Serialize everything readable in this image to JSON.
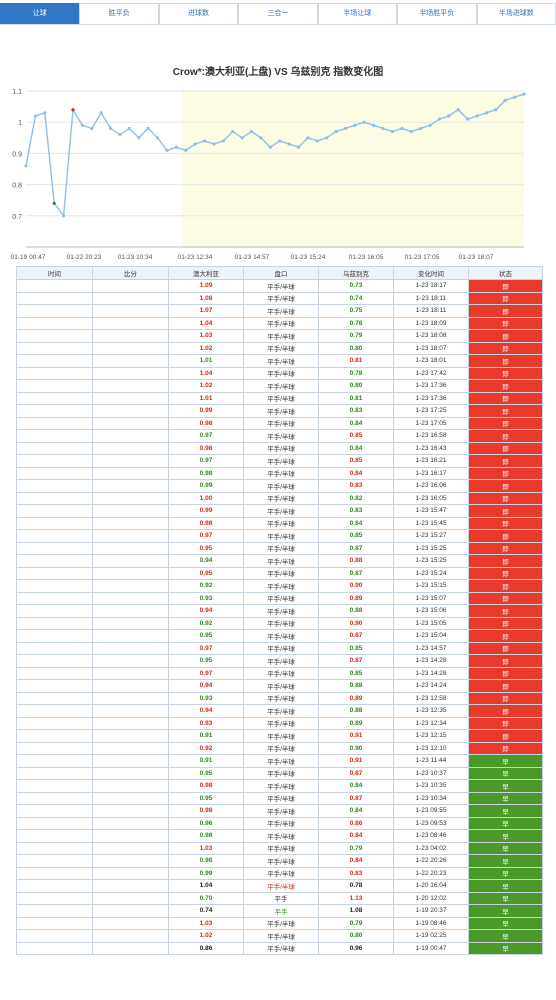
{
  "tabs": [
    {
      "label": "让球",
      "active": true
    },
    {
      "label": "胜平负",
      "active": false
    },
    {
      "label": "进球数",
      "active": false
    },
    {
      "label": "三合一",
      "active": false
    },
    {
      "label": "半场让球",
      "active": false
    },
    {
      "label": "半场胜平负",
      "active": false
    },
    {
      "label": "半场进球数",
      "active": false
    }
  ],
  "colors": {
    "up": "#d42a1a",
    "down": "#2d8a1f",
    "accent": "#2f78c8",
    "closed": "#e8392b",
    "early": "#4a9a2a",
    "line": "#8fbfe8",
    "band": "#fcfbe3"
  },
  "chart_data": {
    "type": "line",
    "title": "Crow*:澳大利亚(上盘) VS 乌兹别克 指数变化图",
    "ylim": [
      0.6,
      1.1
    ],
    "yticks": [
      "0.7",
      "0.8",
      "0.9",
      "1",
      "1.1"
    ],
    "xtick_labels": [
      "01-19 00:47",
      "01-22 20:23",
      "01-23 10:34",
      "01-23 12:34",
      "01-23 14:57",
      "01-23 15:24",
      "01-23 16:05",
      "01-23 17:05",
      "01-23 18:07"
    ],
    "grid": true,
    "legend": "none",
    "values": [
      0.86,
      1.02,
      1.03,
      0.74,
      0.7,
      1.04,
      0.99,
      0.98,
      1.03,
      0.98,
      0.96,
      0.98,
      0.95,
      0.98,
      0.95,
      0.91,
      0.92,
      0.91,
      0.93,
      0.94,
      0.93,
      0.94,
      0.97,
      0.95,
      0.97,
      0.95,
      0.92,
      0.94,
      0.93,
      0.92,
      0.95,
      0.94,
      0.95,
      0.97,
      0.98,
      0.99,
      1.0,
      0.99,
      0.98,
      0.97,
      0.98,
      0.97,
      0.98,
      0.99,
      1.01,
      1.02,
      1.04,
      1.01,
      1.02,
      1.03,
      1.04,
      1.07,
      1.08,
      1.09
    ],
    "highlight_start_index": 16
  },
  "table": {
    "headers": [
      "时间",
      "比分",
      "澳大利亚",
      "盘口",
      "乌兹别克",
      "变化时间",
      "状态"
    ],
    "rows": [
      {
        "home": "1.09",
        "hc": "up",
        "handicap": "平手/半球",
        "hstyle": "",
        "away": "0.73",
        "ac": "down",
        "time": "1-23 18:17",
        "status": "即",
        "sc": "closed"
      },
      {
        "home": "1.08",
        "hc": "up",
        "handicap": "平手/半球",
        "hstyle": "",
        "away": "0.74",
        "ac": "down",
        "time": "1-23 18:11",
        "status": "即",
        "sc": "closed"
      },
      {
        "home": "1.07",
        "hc": "up",
        "handicap": "平手/半球",
        "hstyle": "",
        "away": "0.75",
        "ac": "down",
        "time": "1-23 18:11",
        "status": "即",
        "sc": "closed"
      },
      {
        "home": "1.04",
        "hc": "up",
        "handicap": "平手/半球",
        "hstyle": "",
        "away": "0.78",
        "ac": "down",
        "time": "1-23 18:09",
        "status": "即",
        "sc": "closed"
      },
      {
        "home": "1.03",
        "hc": "up",
        "handicap": "平手/半球",
        "hstyle": "",
        "away": "0.79",
        "ac": "down",
        "time": "1-23 18:08",
        "status": "即",
        "sc": "closed"
      },
      {
        "home": "1.02",
        "hc": "up",
        "handicap": "平手/半球",
        "hstyle": "",
        "away": "0.80",
        "ac": "down",
        "time": "1-23 18:07",
        "status": "即",
        "sc": "closed"
      },
      {
        "home": "1.01",
        "hc": "down",
        "handicap": "平手/半球",
        "hstyle": "",
        "away": "0.81",
        "ac": "up",
        "time": "1-23 18:01",
        "status": "即",
        "sc": "closed"
      },
      {
        "home": "1.04",
        "hc": "up",
        "handicap": "平手/半球",
        "hstyle": "",
        "away": "0.78",
        "ac": "down",
        "time": "1-23 17:42",
        "status": "即",
        "sc": "closed"
      },
      {
        "home": "1.02",
        "hc": "up",
        "handicap": "平手/半球",
        "hstyle": "",
        "away": "0.80",
        "ac": "down",
        "time": "1-23 17:36",
        "status": "即",
        "sc": "closed"
      },
      {
        "home": "1.01",
        "hc": "up",
        "handicap": "平手/半球",
        "hstyle": "",
        "away": "0.81",
        "ac": "down",
        "time": "1-23 17:36",
        "status": "即",
        "sc": "closed"
      },
      {
        "home": "0.99",
        "hc": "up",
        "handicap": "平手/半球",
        "hstyle": "",
        "away": "0.83",
        "ac": "down",
        "time": "1-23 17:25",
        "status": "即",
        "sc": "closed"
      },
      {
        "home": "0.98",
        "hc": "up",
        "handicap": "平手/半球",
        "hstyle": "",
        "away": "0.84",
        "ac": "down",
        "time": "1-23 17:05",
        "status": "即",
        "sc": "closed"
      },
      {
        "home": "0.97",
        "hc": "down",
        "handicap": "平手/半球",
        "hstyle": "",
        "away": "0.85",
        "ac": "up",
        "time": "1-23 16:58",
        "status": "即",
        "sc": "closed"
      },
      {
        "home": "0.98",
        "hc": "up",
        "handicap": "平手/半球",
        "hstyle": "",
        "away": "0.84",
        "ac": "down",
        "time": "1-23 16:43",
        "status": "即",
        "sc": "closed"
      },
      {
        "home": "0.97",
        "hc": "down",
        "handicap": "平手/半球",
        "hstyle": "",
        "away": "0.85",
        "ac": "up",
        "time": "1-23 16:21",
        "status": "即",
        "sc": "closed"
      },
      {
        "home": "0.98",
        "hc": "down",
        "handicap": "平手/半球",
        "hstyle": "",
        "away": "0.84",
        "ac": "up",
        "time": "1-23 16:17",
        "status": "即",
        "sc": "closed"
      },
      {
        "home": "0.99",
        "hc": "down",
        "handicap": "平手/半球",
        "hstyle": "",
        "away": "0.83",
        "ac": "up",
        "time": "1-23 16:06",
        "status": "即",
        "sc": "closed"
      },
      {
        "home": "1.00",
        "hc": "up",
        "handicap": "平手/半球",
        "hstyle": "",
        "away": "0.82",
        "ac": "down",
        "time": "1-23 16:05",
        "status": "即",
        "sc": "closed"
      },
      {
        "home": "0.99",
        "hc": "up",
        "handicap": "平手/半球",
        "hstyle": "",
        "away": "0.83",
        "ac": "down",
        "time": "1-23 15:47",
        "status": "即",
        "sc": "closed"
      },
      {
        "home": "0.98",
        "hc": "up",
        "handicap": "平手/半球",
        "hstyle": "",
        "away": "0.84",
        "ac": "down",
        "time": "1-23 15:45",
        "status": "即",
        "sc": "closed"
      },
      {
        "home": "0.97",
        "hc": "up",
        "handicap": "平手/半球",
        "hstyle": "",
        "away": "0.85",
        "ac": "down",
        "time": "1-23 15:27",
        "status": "即",
        "sc": "closed"
      },
      {
        "home": "0.95",
        "hc": "up",
        "handicap": "平手/半球",
        "hstyle": "",
        "away": "0.87",
        "ac": "down",
        "time": "1-23 15:25",
        "status": "即",
        "sc": "closed"
      },
      {
        "home": "0.94",
        "hc": "down",
        "handicap": "平手/半球",
        "hstyle": "",
        "away": "0.88",
        "ac": "up",
        "time": "1-23 15:25",
        "status": "即",
        "sc": "closed"
      },
      {
        "home": "0.95",
        "hc": "up",
        "handicap": "平手/半球",
        "hstyle": "",
        "away": "0.87",
        "ac": "down",
        "time": "1-23 15:24",
        "status": "即",
        "sc": "closed"
      },
      {
        "home": "0.92",
        "hc": "down",
        "handicap": "平手/半球",
        "hstyle": "",
        "away": "0.90",
        "ac": "up",
        "time": "1-23 15:15",
        "status": "即",
        "sc": "closed"
      },
      {
        "home": "0.93",
        "hc": "down",
        "handicap": "平手/半球",
        "hstyle": "",
        "away": "0.89",
        "ac": "up",
        "time": "1-23 15:07",
        "status": "即",
        "sc": "closed"
      },
      {
        "home": "0.94",
        "hc": "up",
        "handicap": "平手/半球",
        "hstyle": "",
        "away": "0.88",
        "ac": "down",
        "time": "1-23 15:06",
        "status": "即",
        "sc": "closed"
      },
      {
        "home": "0.92",
        "hc": "down",
        "handicap": "平手/半球",
        "hstyle": "",
        "away": "0.90",
        "ac": "up",
        "time": "1-23 15:05",
        "status": "即",
        "sc": "closed"
      },
      {
        "home": "0.95",
        "hc": "down",
        "handicap": "平手/半球",
        "hstyle": "",
        "away": "0.87",
        "ac": "up",
        "time": "1-23 15:04",
        "status": "即",
        "sc": "closed"
      },
      {
        "home": "0.97",
        "hc": "up",
        "handicap": "平手/半球",
        "hstyle": "",
        "away": "0.85",
        "ac": "down",
        "time": "1-23 14:57",
        "status": "即",
        "sc": "closed"
      },
      {
        "home": "0.95",
        "hc": "down",
        "handicap": "平手/半球",
        "hstyle": "",
        "away": "0.87",
        "ac": "up",
        "time": "1-23 14:28",
        "status": "即",
        "sc": "closed"
      },
      {
        "home": "0.97",
        "hc": "up",
        "handicap": "平手/半球",
        "hstyle": "",
        "away": "0.85",
        "ac": "down",
        "time": "1-23 14:28",
        "status": "即",
        "sc": "closed"
      },
      {
        "home": "0.94",
        "hc": "up",
        "handicap": "平手/半球",
        "hstyle": "",
        "away": "0.88",
        "ac": "down",
        "time": "1-23 14:24",
        "status": "即",
        "sc": "closed"
      },
      {
        "home": "0.93",
        "hc": "down",
        "handicap": "平手/半球",
        "hstyle": "",
        "away": "0.89",
        "ac": "up",
        "time": "1-23 12:58",
        "status": "即",
        "sc": "closed"
      },
      {
        "home": "0.94",
        "hc": "up",
        "handicap": "平手/半球",
        "hstyle": "",
        "away": "0.88",
        "ac": "down",
        "time": "1-23 12:35",
        "status": "即",
        "sc": "closed"
      },
      {
        "home": "0.93",
        "hc": "up",
        "handicap": "平手/半球",
        "hstyle": "",
        "away": "0.89",
        "ac": "down",
        "time": "1-23 12:34",
        "status": "即",
        "sc": "closed"
      },
      {
        "home": "0.91",
        "hc": "down",
        "handicap": "平手/半球",
        "hstyle": "",
        "away": "0.91",
        "ac": "up",
        "time": "1-23 12:15",
        "status": "即",
        "sc": "closed"
      },
      {
        "home": "0.92",
        "hc": "up",
        "handicap": "平手/半球",
        "hstyle": "",
        "away": "0.90",
        "ac": "down",
        "time": "1-23 12:10",
        "status": "即",
        "sc": "closed"
      },
      {
        "home": "0.91",
        "hc": "down",
        "handicap": "平手/半球",
        "hstyle": "",
        "away": "0.91",
        "ac": "up",
        "time": "1-23 11:44",
        "status": "早",
        "sc": "early"
      },
      {
        "home": "0.95",
        "hc": "down",
        "handicap": "平手/半球",
        "hstyle": "",
        "away": "0.87",
        "ac": "up",
        "time": "1-23 10:37",
        "status": "早",
        "sc": "early"
      },
      {
        "home": "0.98",
        "hc": "up",
        "handicap": "平手/半球",
        "hstyle": "",
        "away": "0.84",
        "ac": "down",
        "time": "1-23 10:35",
        "status": "早",
        "sc": "early"
      },
      {
        "home": "0.95",
        "hc": "down",
        "handicap": "平手/半球",
        "hstyle": "",
        "away": "0.87",
        "ac": "up",
        "time": "1-23 10:34",
        "status": "早",
        "sc": "early"
      },
      {
        "home": "0.98",
        "hc": "up",
        "handicap": "平手/半球",
        "hstyle": "",
        "away": "0.84",
        "ac": "down",
        "time": "1-23 09:55",
        "status": "早",
        "sc": "early"
      },
      {
        "home": "0.96",
        "hc": "down",
        "handicap": "平手/半球",
        "hstyle": "",
        "away": "0.86",
        "ac": "up",
        "time": "1-23 09:53",
        "status": "早",
        "sc": "early"
      },
      {
        "home": "0.98",
        "hc": "down",
        "handicap": "平手/半球",
        "hstyle": "",
        "away": "0.84",
        "ac": "up",
        "time": "1-23 08:46",
        "status": "早",
        "sc": "early"
      },
      {
        "home": "1.03",
        "hc": "up",
        "handicap": "平手/半球",
        "hstyle": "",
        "away": "0.79",
        "ac": "down",
        "time": "1-23 04:02",
        "status": "早",
        "sc": "early"
      },
      {
        "home": "0.98",
        "hc": "down",
        "handicap": "平手/半球",
        "hstyle": "",
        "away": "0.84",
        "ac": "up",
        "time": "1-22 20:26",
        "status": "早",
        "sc": "early"
      },
      {
        "home": "0.99",
        "hc": "down",
        "handicap": "平手/半球",
        "hstyle": "",
        "away": "0.83",
        "ac": "up",
        "time": "1-22 20:23",
        "status": "早",
        "sc": "early"
      },
      {
        "home": "1.04",
        "hc": "flat",
        "handicap": "平手/半球",
        "hstyle": "hc-red",
        "away": "0.78",
        "ac": "flat",
        "time": "1-20 16:04",
        "status": "早",
        "sc": "early"
      },
      {
        "home": "0.70",
        "hc": "down",
        "handicap": "平手",
        "hstyle": "",
        "away": "1.13",
        "ac": "up",
        "time": "1-20 12:02",
        "status": "早",
        "sc": "early"
      },
      {
        "home": "0.74",
        "hc": "flat",
        "handicap": "平手",
        "hstyle": "hc-green",
        "away": "1.08",
        "ac": "flat",
        "time": "1-19 20:37",
        "status": "早",
        "sc": "early"
      },
      {
        "home": "1.03",
        "hc": "up",
        "handicap": "平手/半球",
        "hstyle": "",
        "away": "0.79",
        "ac": "down",
        "time": "1-19 08:46",
        "status": "早",
        "sc": "early"
      },
      {
        "home": "1.02",
        "hc": "up",
        "handicap": "平手/半球",
        "hstyle": "",
        "away": "0.80",
        "ac": "down",
        "time": "1-19 02:25",
        "status": "早",
        "sc": "early"
      },
      {
        "home": "0.86",
        "hc": "flat",
        "handicap": "平手/半球",
        "hstyle": "",
        "away": "0.96",
        "ac": "flat",
        "time": "1-19 00:47",
        "status": "早",
        "sc": "early"
      }
    ]
  }
}
